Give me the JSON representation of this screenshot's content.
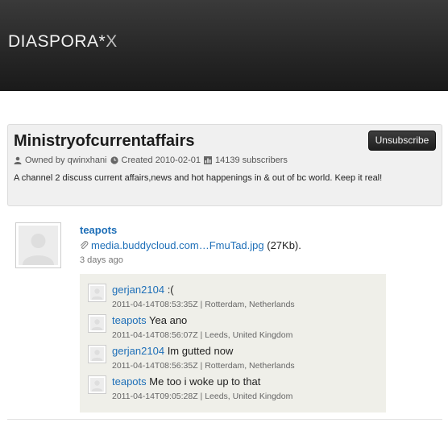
{
  "header": {
    "logo_main": "DIASPORA*",
    "logo_suffix": "X"
  },
  "channel": {
    "title": "Ministryofcurrentaffairs",
    "unsubscribe_label": "Unsubscribe",
    "owner": "Owned by qwinxhani",
    "created": "Created 2010-02-01",
    "subscribers": "14139 subscribers",
    "description": "A channel 2 discuss current affairs,news and hot happenings in & out of bc world. Keep it real!"
  },
  "post": {
    "author": "teapots",
    "attachment_link": "media.buddycloud.com…FmuTad.jpg",
    "attachment_size": "(27Kb).",
    "time": "3 days ago"
  },
  "comments": [
    {
      "author": "gerjan2104",
      "text": ":(",
      "meta": "2011-04-14T08:53:35Z | Rotterdam, Netherlands"
    },
    {
      "author": "teapots",
      "text": "Yea ano",
      "meta": "2011-04-14T08:56:07Z | Leeds, United Kingdom"
    },
    {
      "author": "gerjan2104",
      "text": "Im gutted now",
      "meta": "2011-04-14T08:56:35Z | Rotterdam, Netherlands"
    },
    {
      "author": "teapots",
      "text": "Me too i woke up to that",
      "meta": "2011-04-14T09:05:28Z | Leeds, United Kingdom"
    }
  ],
  "icons": {
    "owner": "user-icon",
    "created": "clock-icon",
    "subscribers": "bar-chart-icon",
    "attachment": "paperclip-icon",
    "avatar": "default-avatar-icon"
  },
  "colors": {
    "link": "#1e6fb8",
    "header_bg": "#262626",
    "comments_bg": "#efefe9"
  }
}
